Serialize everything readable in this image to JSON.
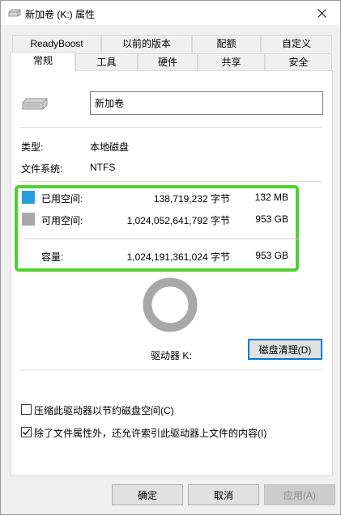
{
  "window": {
    "title": "新加卷 (K:) 属性"
  },
  "tabs": {
    "top_row": [
      "ReadyBoost",
      "以前的版本",
      "配额",
      "自定义"
    ],
    "bottom_row": [
      "常规",
      "工具",
      "硬件",
      "共享",
      "安全"
    ],
    "active": "常规"
  },
  "general": {
    "volume_name": "新加卷",
    "type_label": "类型:",
    "type_value": "本地磁盘",
    "fs_label": "文件系统:",
    "fs_value": "NTFS",
    "used_label": "已用空间:",
    "used_bytes": "138,719,232 字节",
    "used_size": "132 MB",
    "free_label": "可用空间:",
    "free_bytes": "1,024,052,641,792 字节",
    "free_size": "953 GB",
    "capacity_label": "容量:",
    "capacity_bytes": "1,024,191,361,024 字节",
    "capacity_size": "953 GB",
    "drive_label": "驱动器 K:",
    "cleanup_button": "磁盘清理(D)",
    "compress_label": "压缩此驱动器以节约磁盘空间(C)",
    "compress_checked": false,
    "index_label": "除了文件属性外，还允许索引此驱动器上文件的内容(I)",
    "index_checked": true
  },
  "colors": {
    "used": "#26a0da",
    "free": "#a8a8a8",
    "highlight": "#4fd12f"
  },
  "usage": {
    "used_fraction": 0.000135
  },
  "buttons": {
    "ok": "确定",
    "cancel": "取消",
    "apply": "应用(A)"
  }
}
